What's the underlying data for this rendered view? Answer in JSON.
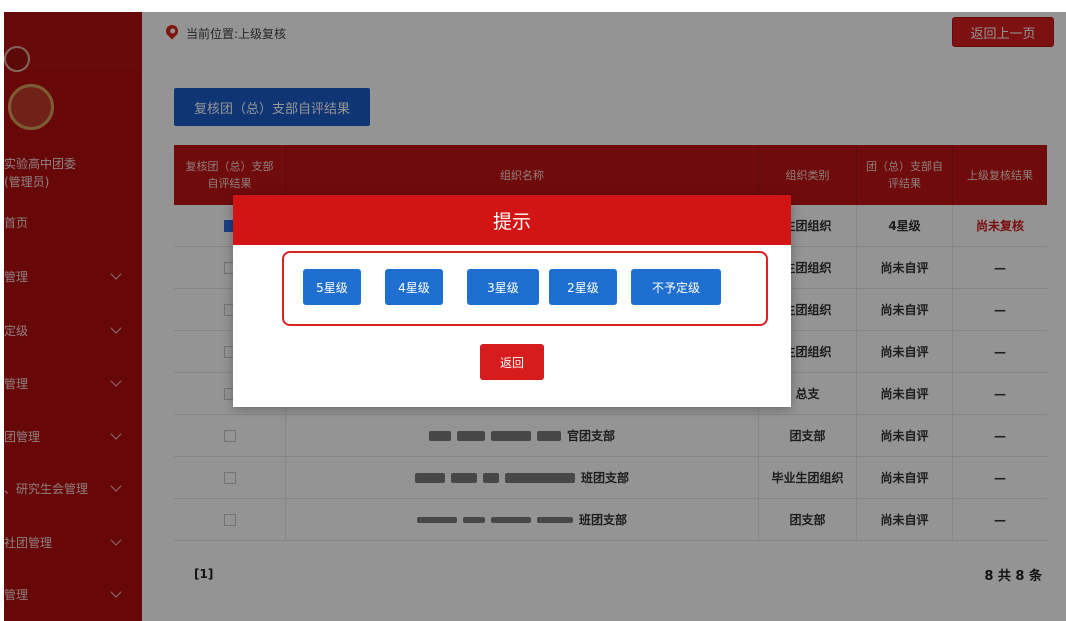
{
  "header": {
    "location": "当前位置:上级复核",
    "back_button": "返回上一页"
  },
  "sidebar": {
    "org_line1": "实验高中团委",
    "org_line2": "(管理员)",
    "items": [
      {
        "label": "首页",
        "has_chevron": false
      },
      {
        "label": "管理",
        "has_chevron": true
      },
      {
        "label": "定级",
        "has_chevron": true
      },
      {
        "label": "管理",
        "has_chevron": true
      },
      {
        "label": "团管理",
        "has_chevron": true
      },
      {
        "label": "、研究生会管理",
        "has_chevron": true
      },
      {
        "label": "社团管理",
        "has_chevron": true
      },
      {
        "label": "管理",
        "has_chevron": true
      }
    ]
  },
  "main": {
    "tab_button": "复核团（总）支部自评结果",
    "table": {
      "columns": [
        "复核团（总）支部自评结果",
        "组织名称",
        "组织类别",
        "团（总）支部自评结果",
        "上级复核结果"
      ],
      "rows": [
        {
          "checked": true,
          "name": "",
          "type": "生团组织",
          "self_eval": "4星级",
          "review": "尚未复核"
        },
        {
          "checked": false,
          "name": "",
          "type": "生团组织",
          "self_eval": "尚未自评",
          "review": "—"
        },
        {
          "checked": false,
          "name": "",
          "type": "生团组织",
          "self_eval": "尚未自评",
          "review": "—"
        },
        {
          "checked": false,
          "name": "",
          "type": "生团组织",
          "self_eval": "尚未自评",
          "review": "—"
        },
        {
          "checked": false,
          "name": "",
          "type": "总支",
          "self_eval": "尚未自评",
          "review": "—"
        },
        {
          "checked": false,
          "name": "官团支部",
          "type": "团支部",
          "self_eval": "尚未自评",
          "review": "—"
        },
        {
          "checked": false,
          "name": "班团支部",
          "type": "毕业生团组织",
          "self_eval": "尚未自评",
          "review": "—"
        },
        {
          "checked": false,
          "name": "班团支部",
          "type": "团支部",
          "self_eval": "尚未自评",
          "review": "—"
        }
      ]
    },
    "pager_pages": "[1]",
    "pager_total": "8 共 8 条"
  },
  "dialog": {
    "title": "提示",
    "options": [
      "5星级",
      "4星级",
      "3星级",
      "2星级",
      "不予定级"
    ],
    "back_button": "返回"
  },
  "colors": {
    "brand_red": "#c11414",
    "button_blue": "#1f6fd1",
    "overlay": "rgba(0,0,0,0.42)"
  }
}
